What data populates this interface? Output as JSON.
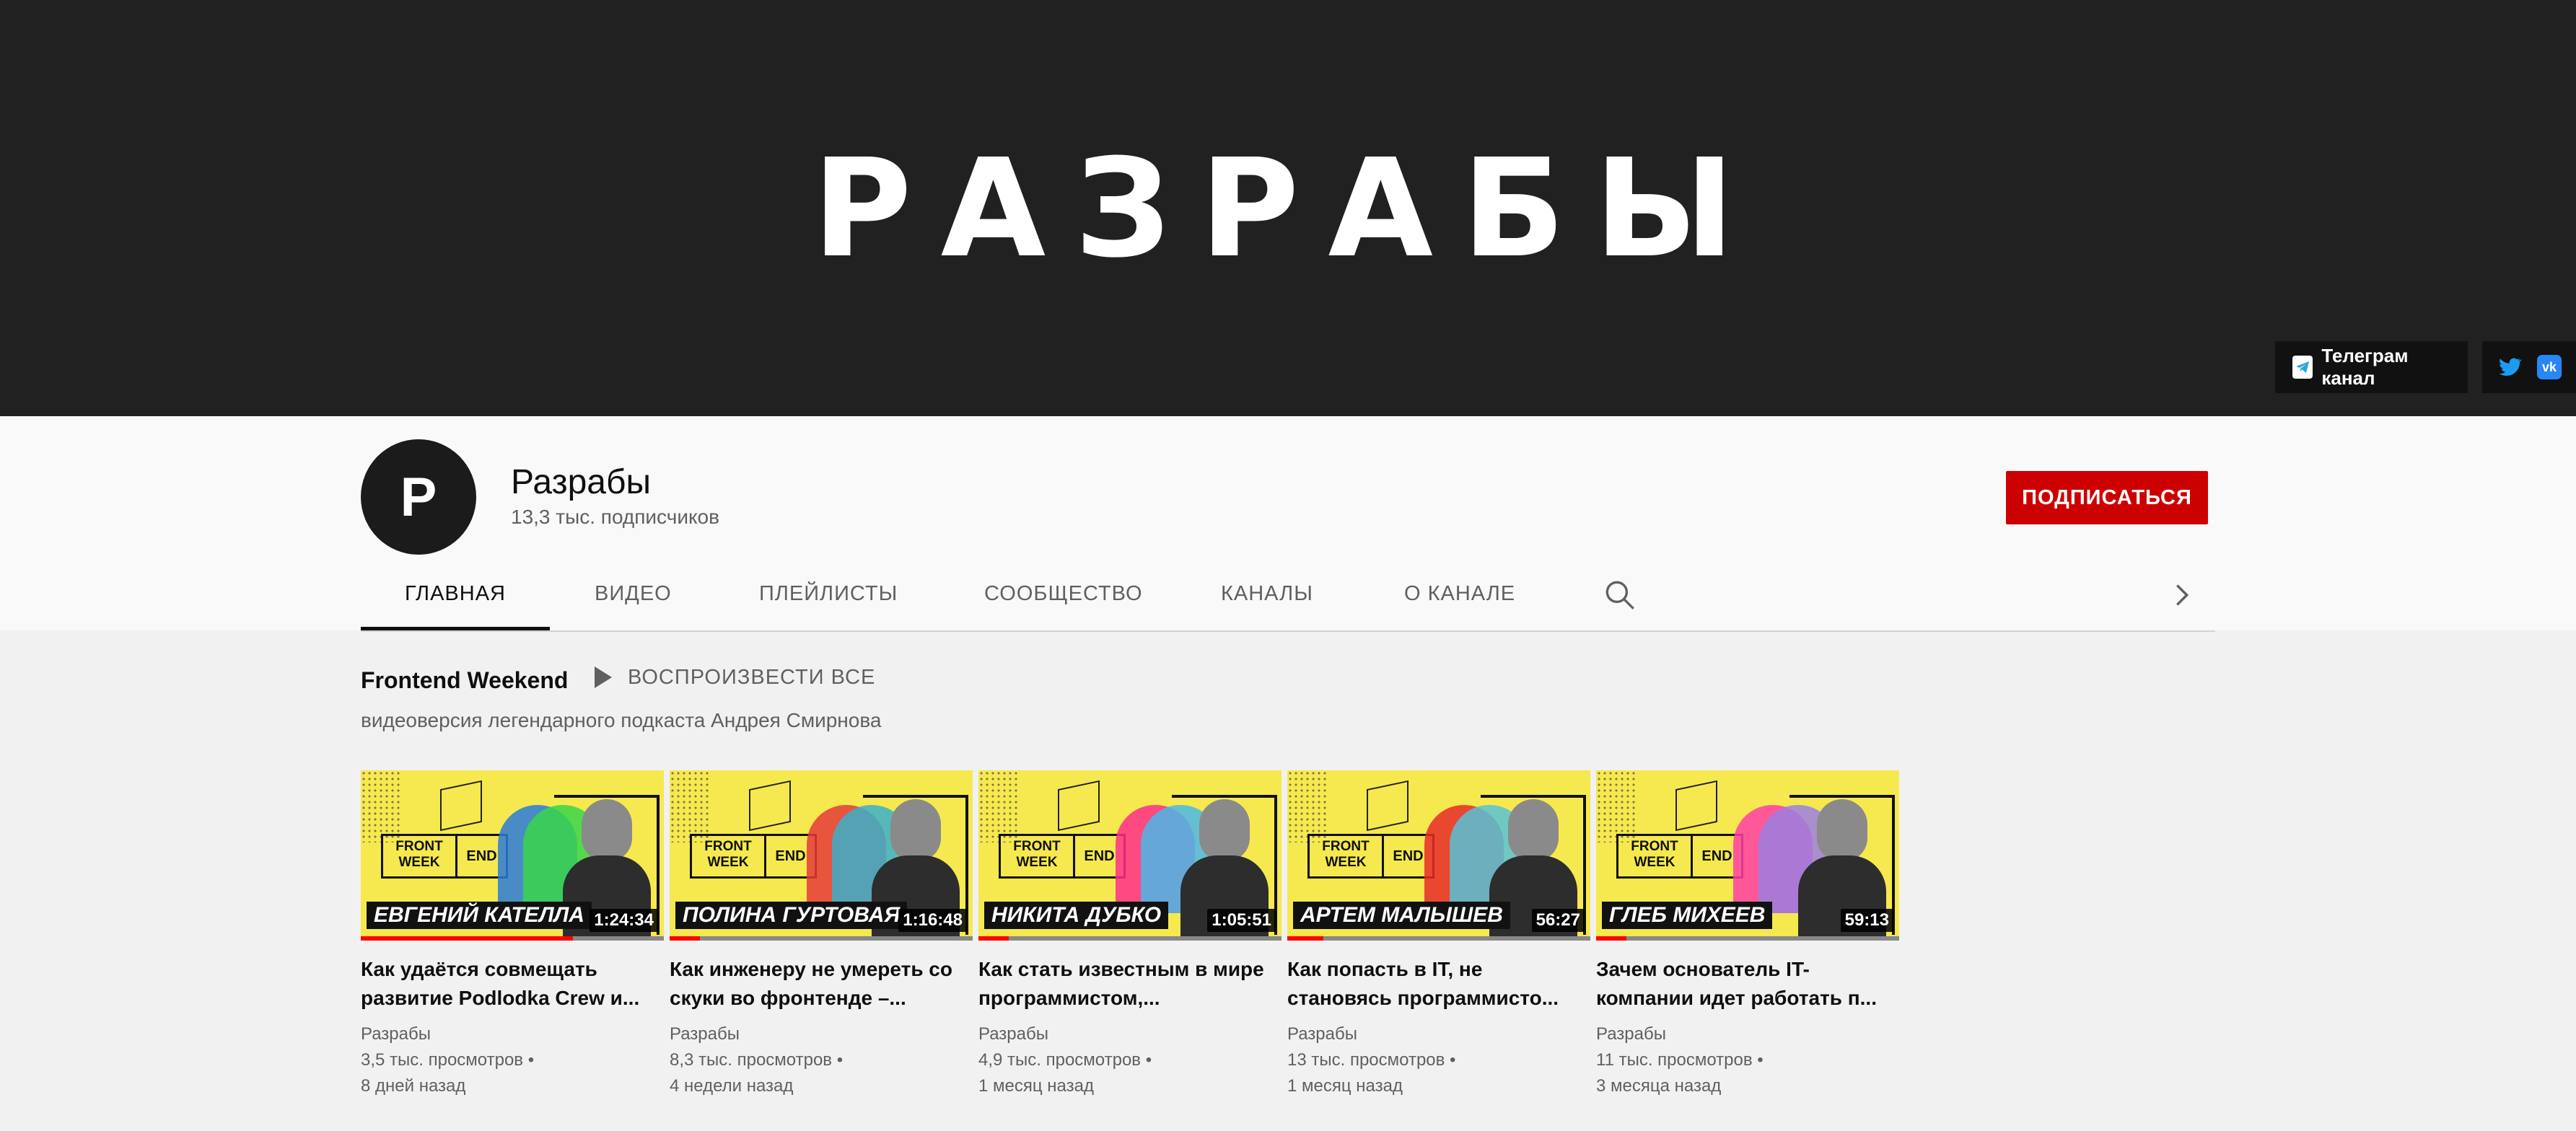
{
  "banner": {
    "title": "РАЗРАБЫ",
    "telegram_label": "Телеграм канал",
    "vk_label": "vk"
  },
  "channel": {
    "avatar_letter": "P",
    "name": "Разрабы",
    "subscribers": "13,3 тыс. подписчиков",
    "subscribe_label": "ПОДПИСАТЬСЯ"
  },
  "tabs": [
    "ГЛАВНАЯ",
    "ВИДЕО",
    "ПЛЕЙЛИСТЫ",
    "СООБЩЕСТВО",
    "КАНАЛЫ",
    "О КАНАЛЕ"
  ],
  "shelf": {
    "title": "Frontend Weekend",
    "play_all": "ВОСПРОИЗВЕСТИ ВСЕ",
    "description": "видеоверсия легендарного подкаста Андрея Смирнова"
  },
  "videos": [
    {
      "guest": "ЕВГЕНИЙ КАТЕЛЛА",
      "duration": "1:24:34",
      "title": "Как удаётся совмещать развитие Podlodka Crew и...",
      "channel": "Разрабы",
      "views": "3,5 тыс. просмотров",
      "age": "8 дней назад",
      "watched": 0.7,
      "ghost_color": "#2a7bd9",
      "ghost_color2": "#38d64a"
    },
    {
      "guest": "ПОЛИНА ГУРТОВАЯ",
      "duration": "1:16:48",
      "title": "Как инженеру не умереть со скуки во фронтенде –...",
      "channel": "Разрабы",
      "views": "8,3 тыс. просмотров",
      "age": "4 недели назад",
      "watched": 0.1,
      "ghost_color": "#e63a3a",
      "ghost_color2": "#3bb0c9"
    },
    {
      "guest": "НИКИТА ДУБКО",
      "duration": "1:05:51",
      "title": "Как стать известным в мире программистом,...",
      "channel": "Разрабы",
      "views": "4,9 тыс. просмотров",
      "age": "1 месяц назад",
      "watched": 0.1,
      "ghost_color": "#ff2d8a",
      "ghost_color2": "#4ab7e8"
    },
    {
      "guest": "АРТЕМ МАЛЫШЕВ",
      "duration": "56:27",
      "title": "Как попасть в IT, не становясь программисто...",
      "channel": "Разрабы",
      "views": "13 тыс. просмотров",
      "age": "1 месяц назад",
      "watched": 0.12,
      "ghost_color": "#e82a2a",
      "ghost_color2": "#57c2d6"
    },
    {
      "guest": "ГЛЕБ МИХЕЕВ",
      "duration": "59:13",
      "title": "Зачем основатель IT-компании идет работать п...",
      "channel": "Разрабы",
      "views": "11 тыс. просмотров",
      "age": "3 месяца назад",
      "watched": 0.1,
      "ghost_color": "#ff3ea5",
      "ghost_color2": "#9b7fe0"
    }
  ]
}
